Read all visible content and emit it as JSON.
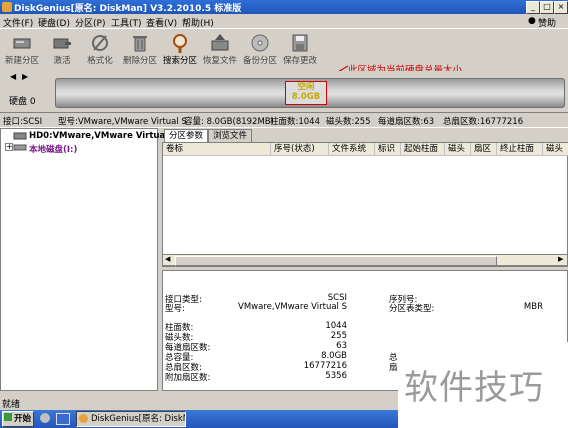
{
  "window": {
    "title": "DiskGenius[原名: DiskMan] V3.2.2010.5 标准版",
    "minimize": "_",
    "maximize": "□",
    "close": "×"
  },
  "menubar": {
    "items": [
      "文件(F)",
      "硬盘(D)",
      "分区(P)",
      "工具(T)",
      "查看(V)",
      "帮助(H)"
    ],
    "help_link": "赞助"
  },
  "toolbar": {
    "buttons": [
      "新建分区",
      "激活",
      "格式化",
      "删除分区",
      "搜索分区",
      "恢复文件",
      "备份分区",
      "保存更改"
    ]
  },
  "disk_map": {
    "disk_label": "硬盘 0",
    "free_label": "空闲",
    "free_size": "8.0GB",
    "annotation": "此区域为当前硬盘总量大小",
    "accent_color": "#d00000"
  },
  "info_line": {
    "interface": "接口:SCSI",
    "model": "型号:VMware,VMware Virtual S",
    "capacity": "容量: 8.0GB(8192MB)",
    "cylinders": "柱面数:1044",
    "heads": "磁头数:255",
    "sectors_per_track": "每道扇区数:63",
    "total_sectors": "总扇区数:16777216"
  },
  "tree": {
    "disk_node": "HD0:VMware,VMware Virtual",
    "local_disk_node": "本地磁盘(I:)"
  },
  "tabs": [
    "分区参数",
    "浏览文件"
  ],
  "partition_table": {
    "columns": [
      "卷标",
      "序号(状态)",
      "文件系统",
      "标识",
      "起始柱面",
      "磁头",
      "扇区",
      "终止柱面",
      "磁头"
    ]
  },
  "detail": {
    "interface_type_label": "接口类型:",
    "interface_type_value": "SCSI",
    "serial_label": "序列号:",
    "model_label": "型号:",
    "model_value": "VMware,VMware Virtual S",
    "partition_table_type_label": "分区表类型:",
    "partition_table_type_value": "MBR",
    "cylinders_label": "柱面数:",
    "cylinders_value": "1044",
    "heads_label": "磁头数:",
    "heads_value": "255",
    "spt_label": "每道扇区数:",
    "spt_value": "63",
    "capacity_label": "总容量:",
    "capacity_value": "8.0GB",
    "total_bytes_label": "总字节数:",
    "total_sectors_label": "总扇区数:",
    "total_sectors_value": "16777216",
    "sector_size_label": "扇区大小:",
    "extra_sectors_label": "附加扇区数:",
    "extra_sectors_value": "5356"
  },
  "status": {
    "text": "就绪"
  },
  "taskbar": {
    "start": "开始",
    "task_item": "DiskGenius[原名: DiskMan..."
  },
  "watermark": {
    "text": "软件技巧"
  }
}
